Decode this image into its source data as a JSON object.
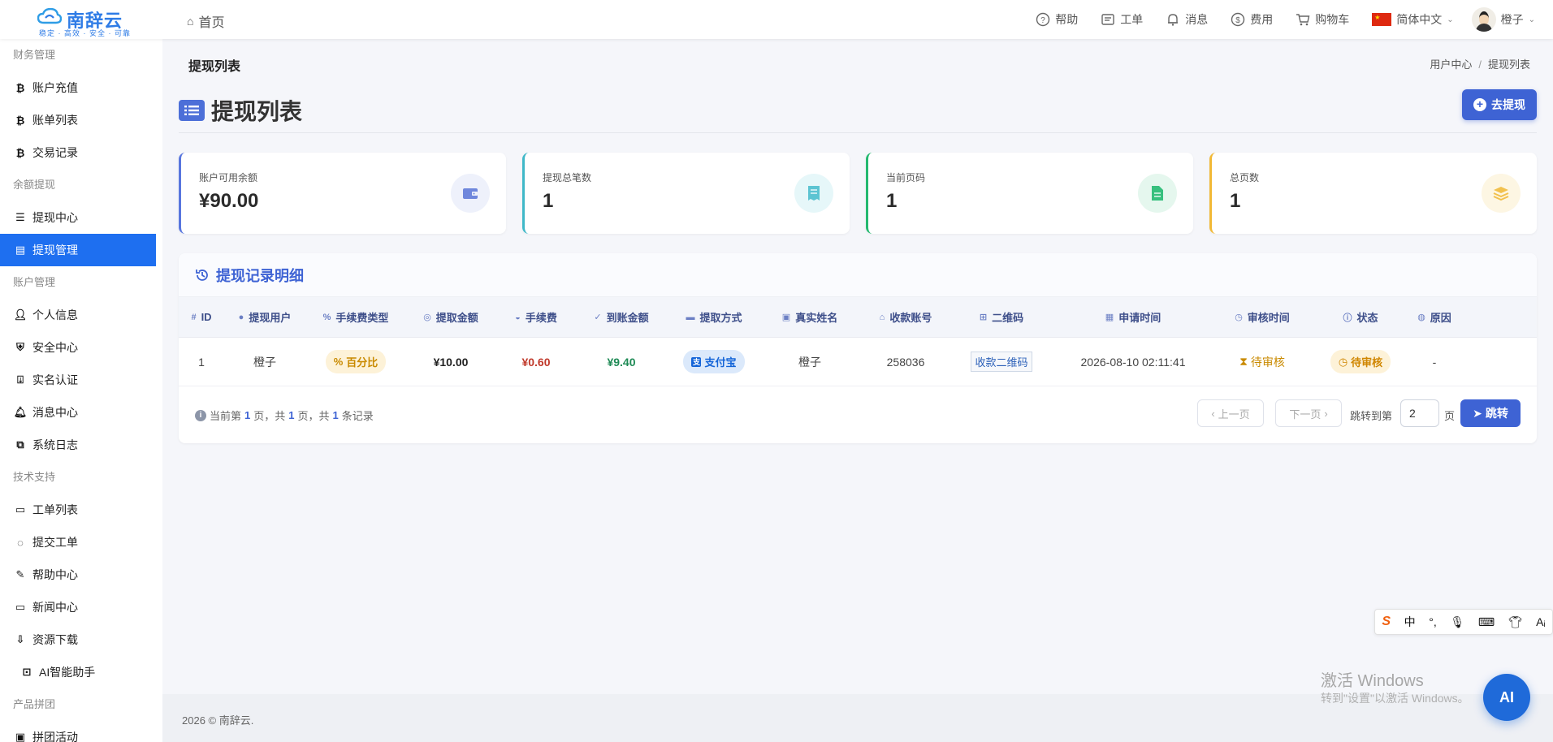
{
  "header": {
    "brand": "南辞云",
    "slogan": "稳定 · 高效 · 安全 · 可靠",
    "home_label": "首页",
    "nav": [
      {
        "label": "帮助",
        "icon": "help-circle-icon"
      },
      {
        "label": "工单",
        "icon": "ticket-icon"
      },
      {
        "label": "消息",
        "icon": "bell-icon"
      },
      {
        "label": "费用",
        "icon": "dollar-circle-icon"
      },
      {
        "label": "购物车",
        "icon": "cart-icon"
      }
    ],
    "language": "简体中文",
    "user": "橙子"
  },
  "sidebar": {
    "g1": "财务管理",
    "i1": "账户充值",
    "i2": "账单列表",
    "i3": "交易记录",
    "g2": "余额提现",
    "i4": "提现中心",
    "i5": "提现管理",
    "g3": "账户管理",
    "i6": "个人信息",
    "i7": "安全中心",
    "i8": "实名认证",
    "i9": "消息中心",
    "i10": "系统日志",
    "g4": "技术支持",
    "i11": "工单列表",
    "i12": "提交工单",
    "i13": "帮助中心",
    "i14": "新闻中心",
    "i15": "资源下载",
    "i16": "AI智能助手",
    "g5": "产品拼团",
    "i17": "拼团活动"
  },
  "page": {
    "crumb_title": "提现列表",
    "breadcrumb_root": "用户中心",
    "breadcrumb_sep": "/",
    "breadcrumb_current": "提现列表",
    "heading": "提现列表",
    "withdraw_button": "去提现"
  },
  "stats": [
    {
      "label": "账户可用余额",
      "value": "¥90.00",
      "icon": "wallet-icon",
      "color": "#5876de",
      "bg": "#eef1fb"
    },
    {
      "label": "提现总笔数",
      "value": "1",
      "icon": "receipt-icon",
      "color": "#3fb8c8",
      "bg": "#e6f7f9"
    },
    {
      "label": "当前页码",
      "value": "1",
      "icon": "document-icon",
      "color": "#25b970",
      "bg": "#e5f7ee"
    },
    {
      "label": "总页数",
      "value": "1",
      "icon": "layers-icon",
      "color": "#f2b935",
      "bg": "#fdf6e3"
    }
  ],
  "records": {
    "title": "提现记录明细",
    "columns": [
      {
        "label": "ID",
        "icon": "#"
      },
      {
        "label": "提现用户",
        "icon": "user-icon"
      },
      {
        "label": "手续费类型",
        "icon": "percent-icon"
      },
      {
        "label": "提取金额",
        "icon": "coins-icon"
      },
      {
        "label": "手续费",
        "icon": "hand-coin-icon"
      },
      {
        "label": "到账金额",
        "icon": "check-double-icon"
      },
      {
        "label": "提取方式",
        "icon": "card-icon"
      },
      {
        "label": "真实姓名",
        "icon": "id-card-icon"
      },
      {
        "label": "收款账号",
        "icon": "bank-icon"
      },
      {
        "label": "二维码",
        "icon": "qrcode-icon"
      },
      {
        "label": "申请时间",
        "icon": "calendar-icon"
      },
      {
        "label": "审核时间",
        "icon": "clock-icon"
      },
      {
        "label": "状态",
        "icon": "info-icon"
      },
      {
        "label": "原因",
        "icon": "comment-icon"
      }
    ],
    "rows": [
      {
        "id": "1",
        "user": "橙子",
        "fee_type": "百分比",
        "amount": "¥10.00",
        "fee": "¥0.60",
        "received": "¥9.40",
        "method": "支付宝",
        "real_name": "橙子",
        "account": "258036",
        "qr": "收款二维码",
        "apply_time": "2026-08-10 02:11:41",
        "review_time": "待审核",
        "status": "待审核",
        "reason": "-"
      }
    ]
  },
  "pager": {
    "info_prefix": "当前第",
    "current": "1",
    "info_mid1": "页，共",
    "total_pages": "1",
    "info_mid2": "页，共",
    "total_records": "1",
    "info_suffix": "条记录",
    "prev": "上一页",
    "next": "下一页",
    "jump_label": "跳转到第",
    "jump_value": "2",
    "page_unit": "页",
    "go": "跳转"
  },
  "footer": "2026 © 南辞云.",
  "ime": {
    "chinese": "中"
  },
  "watermark": {
    "line1": "激活 Windows",
    "line2": "转到\"设置\"以激活 Windows。"
  },
  "ai_button": "AI"
}
